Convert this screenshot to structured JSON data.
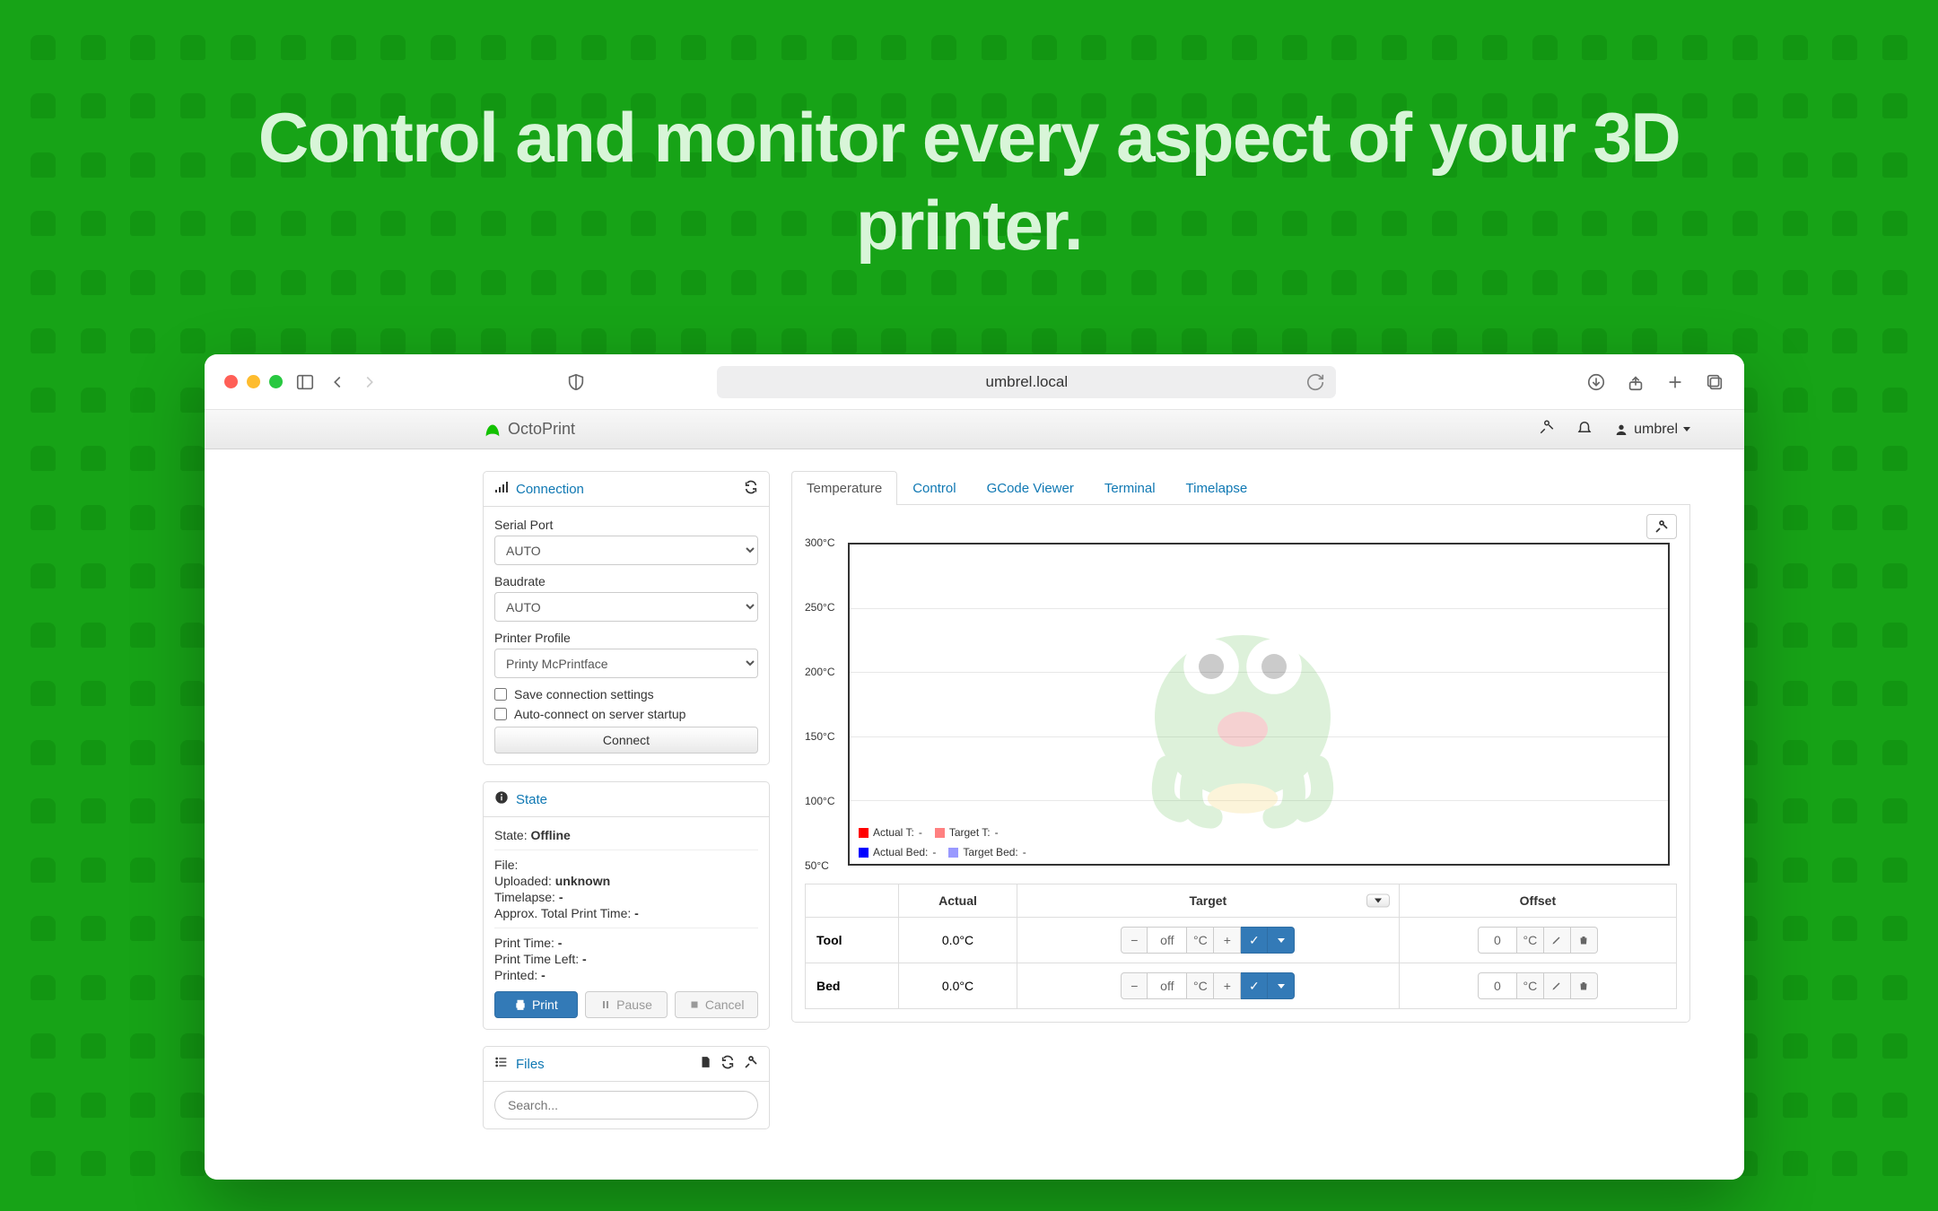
{
  "hero": "Control and monitor every aspect of your 3D printer.",
  "browser": {
    "url": "umbrel.local"
  },
  "navbar": {
    "brand": "OctoPrint",
    "user": "umbrel"
  },
  "sidebar": {
    "connection": {
      "title": "Connection",
      "serial_port_label": "Serial Port",
      "serial_port_value": "AUTO",
      "baudrate_label": "Baudrate",
      "baudrate_value": "AUTO",
      "profile_label": "Printer Profile",
      "profile_value": "Printy McPrintface",
      "save_label": "Save connection settings",
      "autoconnect_label": "Auto-connect on server startup",
      "connect_button": "Connect"
    },
    "state": {
      "title": "State",
      "state_label": "State:",
      "state_value": "Offline",
      "file_label": "File:",
      "file_value": "",
      "uploaded_label": "Uploaded:",
      "uploaded_value": "unknown",
      "timelapse_label": "Timelapse:",
      "timelapse_value": "-",
      "approx_label": "Approx. Total Print Time:",
      "approx_value": "-",
      "printtime_label": "Print Time:",
      "printtime_value": "-",
      "printleft_label": "Print Time Left:",
      "printleft_value": "-",
      "printed_label": "Printed:",
      "printed_value": "-",
      "btn_print": "Print",
      "btn_pause": "Pause",
      "btn_cancel": "Cancel"
    },
    "files": {
      "title": "Files",
      "search_placeholder": "Search..."
    }
  },
  "tabs": [
    "Temperature",
    "Control",
    "GCode Viewer",
    "Terminal",
    "Timelapse"
  ],
  "chart_data": {
    "type": "line",
    "ylabel_ticks": [
      "300°C",
      "250°C",
      "200°C",
      "150°C",
      "100°C",
      "50°C"
    ],
    "ylim": [
      0,
      300
    ],
    "series": [
      {
        "name": "Actual T:",
        "value": "-",
        "color": "#ff0000"
      },
      {
        "name": "Target T:",
        "value": "-",
        "color": "#ff8080"
      },
      {
        "name": "Actual Bed:",
        "value": "-",
        "color": "#0000ff"
      },
      {
        "name": "Target Bed:",
        "value": "-",
        "color": "#9999ff"
      }
    ]
  },
  "temp_table": {
    "headers": {
      "actual": "Actual",
      "target": "Target",
      "offset": "Offset"
    },
    "rows": [
      {
        "label": "Tool",
        "actual": "0.0°C",
        "target_value": "off",
        "target_unit": "°C",
        "offset_value": "0",
        "offset_unit": "°C"
      },
      {
        "label": "Bed",
        "actual": "0.0°C",
        "target_value": "off",
        "target_unit": "°C",
        "offset_value": "0",
        "offset_unit": "°C"
      }
    ]
  }
}
